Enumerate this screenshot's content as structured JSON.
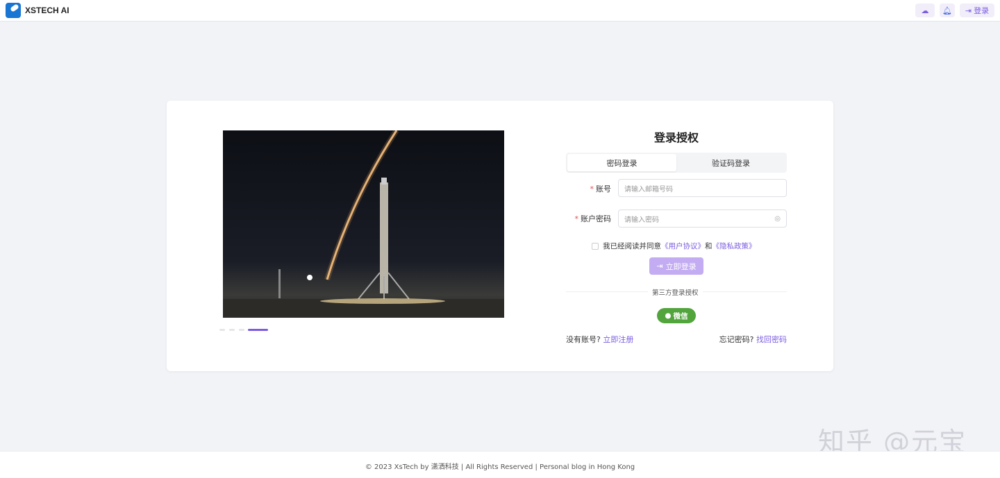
{
  "header": {
    "brand": "XSTECH AI",
    "login_label": "登录",
    "icons": [
      "wechat-icon",
      "bell-icon",
      "login-icon"
    ]
  },
  "carousel": {
    "slide_count": 4,
    "active_index": 3
  },
  "form": {
    "title": "登录授权",
    "tabs": [
      {
        "label": "密码登录",
        "active": true
      },
      {
        "label": "验证码登录",
        "active": false
      }
    ],
    "account_label": "账号",
    "account_placeholder": "请输入邮箱号码",
    "password_label": "账户密码",
    "password_placeholder": "请输入密码",
    "required_mark": "*",
    "agree_text": "我已经阅读并同意",
    "agree_and": "和",
    "user_agreement": "《用户协议》",
    "privacy_policy": "《隐私政策》",
    "submit_label": "立即登录",
    "third_party_label": "第三方登录授权",
    "wechat_label": "微信",
    "no_account": "没有账号?",
    "register": "立即注册",
    "forgot": "忘记密码?",
    "recover": "找回密码"
  },
  "footer": {
    "text": "© 2023 XsTech by 潇洒科技 | All Rights Reserved | Personal blog in Hong Kong"
  },
  "watermark": "知乎 @元宝",
  "colors": {
    "accent": "#7b5ce0",
    "button": "#c3acf2",
    "wechat": "#52a43c",
    "required": "#e34d4d"
  }
}
